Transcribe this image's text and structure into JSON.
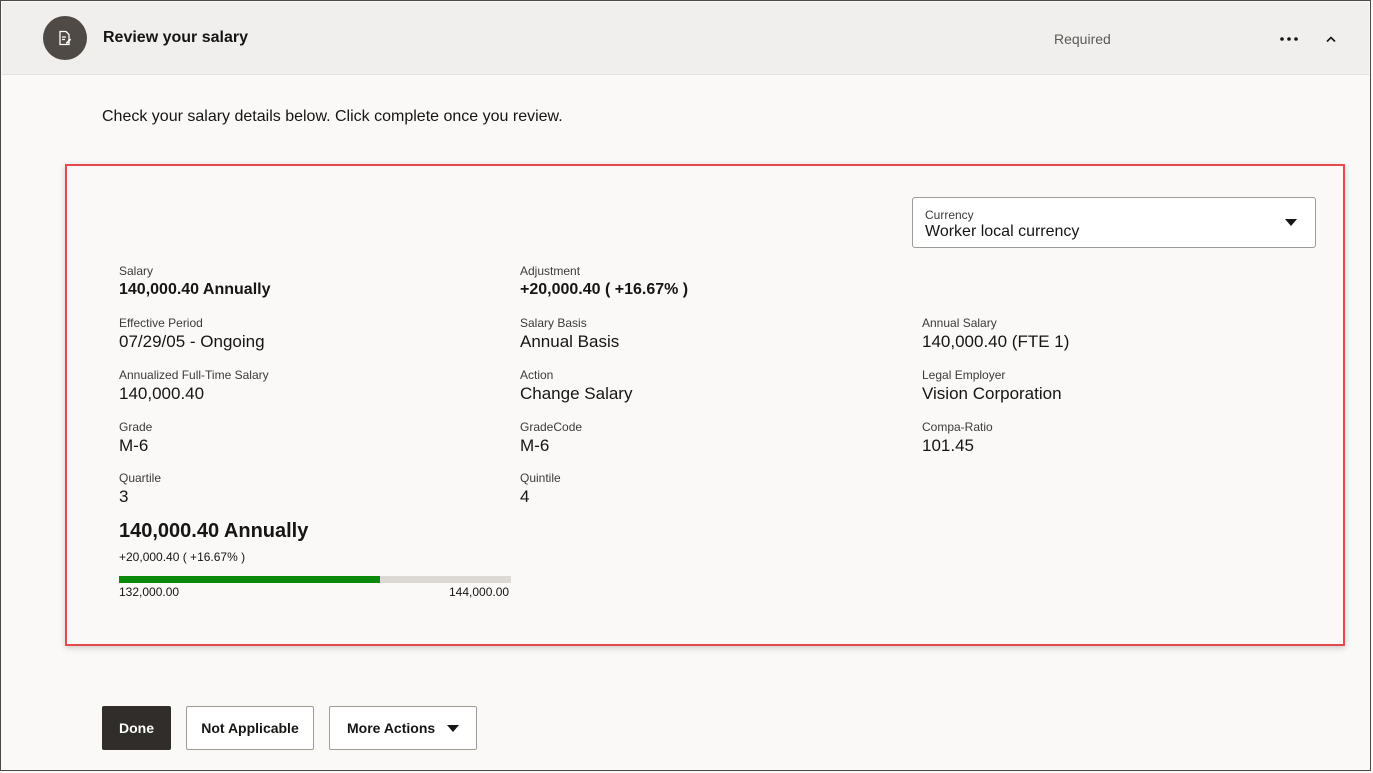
{
  "header": {
    "title": "Review your salary",
    "status": "Required",
    "icon": "task-document-icon",
    "more_icon": "ellipsis-icon",
    "collapse_icon": "chevron-up-icon"
  },
  "instructions": "Check your salary details below. Click complete once you review.",
  "currency": {
    "label": "Currency",
    "value": "Worker local currency"
  },
  "fields": {
    "salary": {
      "label": "Salary",
      "value": "140,000.40 Annually"
    },
    "adjustment": {
      "label": "Adjustment",
      "value": "+20,000.40 ( +16.67% )"
    },
    "effective_period": {
      "label": "Effective Period",
      "value": "07/29/05 - Ongoing"
    },
    "salary_basis": {
      "label": "Salary Basis",
      "value": "Annual Basis"
    },
    "annual_salary": {
      "label": "Annual Salary",
      "value": "140,000.40 (FTE 1)"
    },
    "annualized_fulltime": {
      "label": "Annualized Full-Time Salary",
      "value": "140,000.40"
    },
    "action": {
      "label": "Action",
      "value": "Change Salary"
    },
    "legal_employer": {
      "label": "Legal Employer",
      "value": "Vision Corporation"
    },
    "grade": {
      "label": "Grade",
      "value": "M-6"
    },
    "grade_code": {
      "label": "GradeCode",
      "value": "M-6"
    },
    "compa_ratio": {
      "label": "Compa-Ratio",
      "value": "101.45"
    },
    "quartile": {
      "label": "Quartile",
      "value": "3"
    },
    "quintile": {
      "label": "Quintile",
      "value": "4"
    }
  },
  "summary": {
    "salary": "140,000.40 Annually",
    "adjustment": "+20,000.40 ( +16.67% )",
    "range_min": "132,000.00",
    "range_max": "144,000.00",
    "range_fill_fraction": 0.667,
    "range_color": "#0a8a0a"
  },
  "buttons": {
    "done": "Done",
    "not_applicable": "Not Applicable",
    "more_actions": "More Actions"
  },
  "colors": {
    "highlight_border": "#e5484d",
    "primary_button": "#312d2a"
  }
}
